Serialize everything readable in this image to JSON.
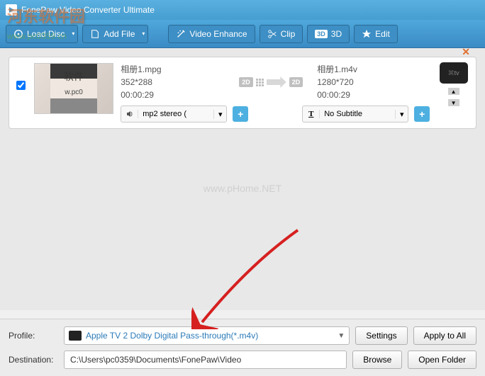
{
  "app": {
    "title": "FonePaw Video Converter Ultimate"
  },
  "toolbar": {
    "load_disc": "Load Disc",
    "add_file": "Add File",
    "video_enhance": "Video Enhance",
    "clip": "Clip",
    "three_d": "3D",
    "edit": "Edit"
  },
  "watermark": {
    "site_name": "河东软件园",
    "site_url": "www.pc0359.cn",
    "center": "www.pHome.NET"
  },
  "item": {
    "thumb_label": "软件",
    "thumb_url": "w.pc0",
    "source": {
      "filename": "相册1.mpg",
      "resolution": "352*288",
      "duration": "00:00:29"
    },
    "target": {
      "filename": "相册1.m4v",
      "resolution": "1280*720",
      "duration": "00:00:29"
    },
    "audio_track": "mp2 stereo (",
    "subtitle": "No Subtitle",
    "device_label": "tv",
    "badge_in": "2D",
    "badge_out": "2D"
  },
  "footer": {
    "profile_label": "Profile:",
    "profile_value": "Apple TV 2 Dolby Digital Pass-through(*.m4v)",
    "destination_label": "Destination:",
    "destination_value": "C:\\Users\\pc0359\\Documents\\FonePaw\\Video",
    "settings": "Settings",
    "apply_all": "Apply to All",
    "browse": "Browse",
    "open_folder": "Open Folder"
  }
}
